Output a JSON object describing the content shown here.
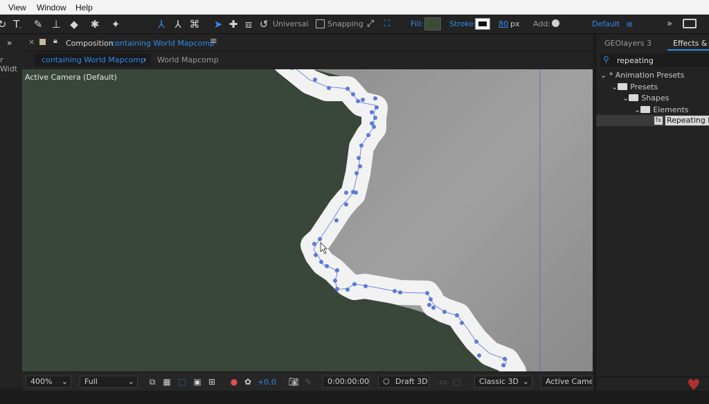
{
  "menu": {
    "items": [
      "View",
      "Window",
      "Help"
    ]
  },
  "toolbar": {
    "universal_label": "Universal",
    "snapping_label": "Snapping",
    "fill_label": "Fill:",
    "fill_color": "#3c4a38",
    "stroke_label": "Stroke:",
    "stroke_width": "80",
    "stroke_unit": "px",
    "add_label": "Add:",
    "workspace": "Default"
  },
  "left_strip": {
    "label": "r Widt"
  },
  "comp_panel": {
    "title_prefix": "Composition",
    "title_name": "containing World Mapcomp",
    "tabs": [
      "containing World Mapcomp",
      "World Mapcomp"
    ]
  },
  "viewer": {
    "camera_label": "Active Camera (Default)",
    "bg_color": "#39463a",
    "zoom": "400%",
    "resolution": "Full",
    "exposure": "+0.0",
    "timecode": "0:00:00:00",
    "draft3d_label": "Draft 3D",
    "renderer": "Classic 3D",
    "view": "Active Camer..."
  },
  "right_panel": {
    "tabs": [
      "GEOlayers 3",
      "Effects & P"
    ],
    "search_value": "repeating",
    "tree": [
      {
        "label": "* Animation Presets",
        "level": 0
      },
      {
        "label": "Presets",
        "level": 1
      },
      {
        "label": "Shapes",
        "level": 2
      },
      {
        "label": "Elements",
        "level": 3
      },
      {
        "label": "Repeating Li",
        "level": 4
      }
    ]
  }
}
